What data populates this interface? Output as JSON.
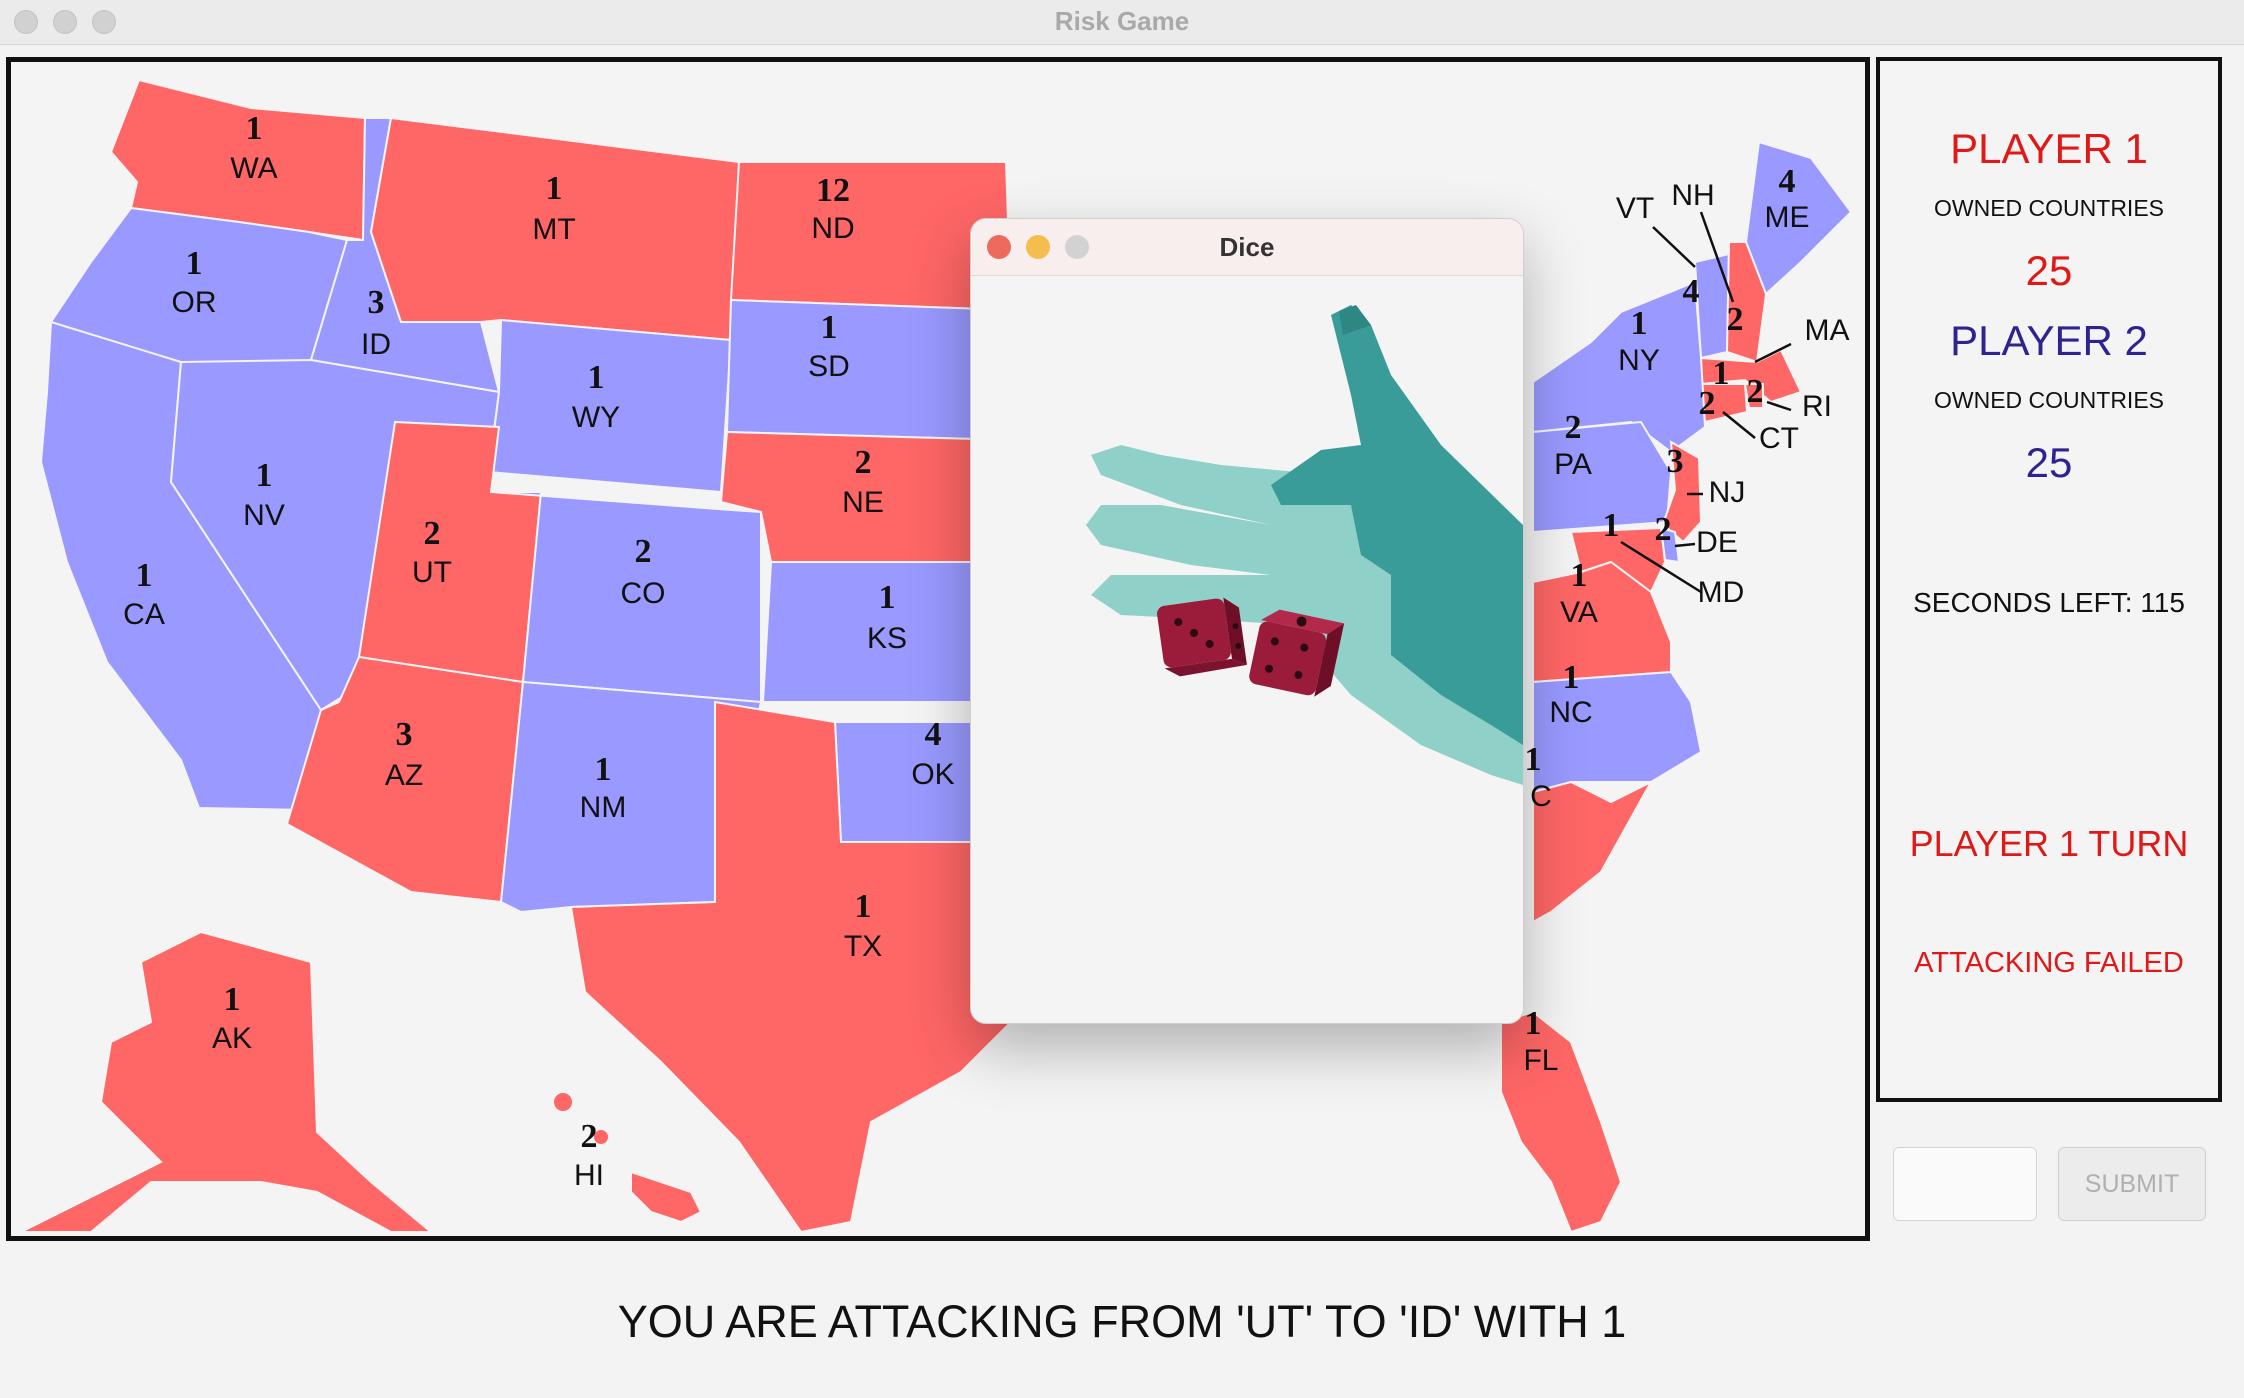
{
  "window": {
    "title": "Risk Game"
  },
  "colors": {
    "player1": "#ff6666",
    "player2": "#9999ff",
    "player1_text": "#e01818",
    "player2_text": "#2f2391"
  },
  "states": {
    "WA": {
      "label": "WA",
      "troops": "1",
      "owner": "p1"
    },
    "OR": {
      "label": "OR",
      "troops": "1",
      "owner": "p2"
    },
    "CA": {
      "label": "CA",
      "troops": "1",
      "owner": "p2"
    },
    "ID": {
      "label": "ID",
      "troops": "3",
      "owner": "p2"
    },
    "NV": {
      "label": "NV",
      "troops": "1",
      "owner": "p2"
    },
    "MT": {
      "label": "MT",
      "troops": "1",
      "owner": "p1"
    },
    "WY": {
      "label": "WY",
      "troops": "1",
      "owner": "p2"
    },
    "UT": {
      "label": "UT",
      "troops": "2",
      "owner": "p1"
    },
    "AZ": {
      "label": "AZ",
      "troops": "3",
      "owner": "p1"
    },
    "CO": {
      "label": "CO",
      "troops": "2",
      "owner": "p2"
    },
    "NM": {
      "label": "NM",
      "troops": "1",
      "owner": "p2"
    },
    "ND": {
      "label": "ND",
      "troops": "12",
      "owner": "p1"
    },
    "SD": {
      "label": "SD",
      "troops": "1",
      "owner": "p2"
    },
    "NE": {
      "label": "NE",
      "troops": "2",
      "owner": "p1"
    },
    "KS": {
      "label": "KS",
      "troops": "1",
      "owner": "p2"
    },
    "OK": {
      "label": "OK",
      "troops": "4",
      "owner": "p2"
    },
    "TX": {
      "label": "TX",
      "troops": "1",
      "owner": "p1"
    },
    "AK": {
      "label": "AK",
      "troops": "1",
      "owner": "p1"
    },
    "HI": {
      "label": "HI",
      "troops": "2",
      "owner": "p1"
    },
    "ME": {
      "label": "ME",
      "troops": "4",
      "owner": "p2"
    },
    "VT": {
      "label": "VT",
      "troops": "4",
      "owner": "p2"
    },
    "NH": {
      "label": "NH",
      "troops": "2",
      "owner": "p1"
    },
    "MA": {
      "label": "MA",
      "troops": "1",
      "owner": "p1"
    },
    "RI": {
      "label": "RI",
      "troops": "2",
      "owner": "p1"
    },
    "CT": {
      "label": "CT",
      "troops": "2",
      "owner": "p1"
    },
    "NY": {
      "label": "NY",
      "troops": "1",
      "owner": "p2"
    },
    "PA": {
      "label": "PA",
      "troops": "2",
      "owner": "p2"
    },
    "NJ": {
      "label": "NJ",
      "troops": "3",
      "owner": "p1"
    },
    "DE": {
      "label": "DE",
      "troops": "2",
      "owner": "p2"
    },
    "MD": {
      "label": "MD",
      "troops": "1",
      "owner": "p1"
    },
    "VA": {
      "label": "VA",
      "troops": "1",
      "owner": "p1"
    },
    "NC": {
      "label": "NC",
      "troops": "1",
      "owner": "p2"
    },
    "SC": {
      "label": "C",
      "troops": "1",
      "owner": "p1"
    },
    "FL": {
      "label": "FL",
      "troops": "1",
      "owner": "p1"
    }
  },
  "side_panel": {
    "player1": {
      "name": "PLAYER 1",
      "owned_label": "OWNED COUNTRIES",
      "owned_count": "25"
    },
    "player2": {
      "name": "PLAYER 2",
      "owned_label": "OWNED COUNTRIES",
      "owned_count": "25"
    },
    "timer": "SECONDS LEFT: 115",
    "turn": "PLAYER 1 TURN",
    "status": "ATTACKING FAILED"
  },
  "controls": {
    "input_value": "",
    "submit_label": "SUBMIT"
  },
  "message": "YOU ARE ATTACKING FROM 'UT' TO 'ID' WITH 1",
  "dice_dialog": {
    "title": "Dice"
  }
}
